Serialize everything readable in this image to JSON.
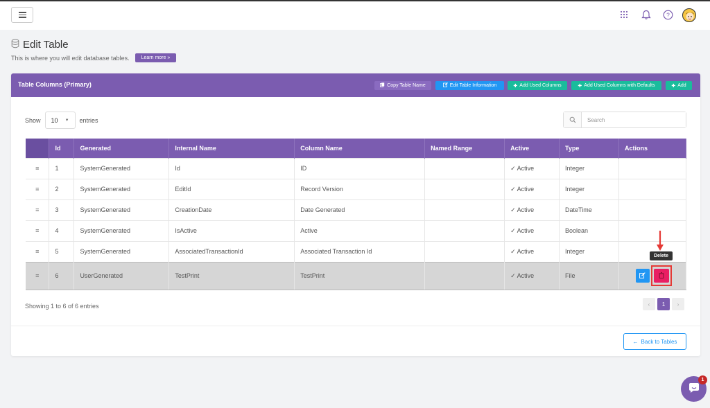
{
  "header": {
    "icons": [
      "menu-icon",
      "apps-grid-icon",
      "bell-icon",
      "help-icon",
      "user-avatar"
    ]
  },
  "page": {
    "title": "Edit Table",
    "subtitle": "This is where you will edit database tables.",
    "learn_more": "Learn more »"
  },
  "card": {
    "title": "Table Columns (Primary)",
    "buttons": {
      "copy": "Copy Table Name",
      "edit_info": "Edit Table Information",
      "add_used": "Add Used Columns",
      "add_used_defaults": "Add Used Columns with Defaults",
      "add": "Add"
    }
  },
  "controls": {
    "show_label": "Show",
    "entries_value": "10",
    "entries_label": "entries",
    "search_placeholder": "Search"
  },
  "table": {
    "headers": [
      "",
      "Id",
      "Generated",
      "Internal Name",
      "Column Name",
      "Named Range",
      "Active",
      "Type",
      "Actions"
    ],
    "rows": [
      {
        "handle": "≡",
        "id": "1",
        "generated": "SystemGenerated",
        "internal": "Id",
        "column": "ID",
        "range": "",
        "active": "✓ Active",
        "type": "Integer"
      },
      {
        "handle": "≡",
        "id": "2",
        "generated": "SystemGenerated",
        "internal": "EditId",
        "column": "Record Version",
        "range": "",
        "active": "✓ Active",
        "type": "Integer"
      },
      {
        "handle": "≡",
        "id": "3",
        "generated": "SystemGenerated",
        "internal": "CreationDate",
        "column": "Date Generated",
        "range": "",
        "active": "✓ Active",
        "type": "DateTime"
      },
      {
        "handle": "≡",
        "id": "4",
        "generated": "SystemGenerated",
        "internal": "IsActive",
        "column": "Active",
        "range": "",
        "active": "✓ Active",
        "type": "Boolean"
      },
      {
        "handle": "≡",
        "id": "5",
        "generated": "SystemGenerated",
        "internal": "AssociatedTransactionId",
        "column": "Associated Transaction Id",
        "range": "",
        "active": "✓ Active",
        "type": "Integer"
      },
      {
        "handle": "≡",
        "id": "6",
        "generated": "UserGenerated",
        "internal": "TestPrint",
        "column": "TestPrint",
        "range": "",
        "active": "✓ Active",
        "type": "File"
      }
    ]
  },
  "tooltip": "Delete",
  "footer": {
    "info": "Showing 1 to 6 of 6 entries",
    "page": "1",
    "prev": "‹",
    "next": "›",
    "back": "Back to Tables"
  },
  "chat": {
    "badge": "1"
  },
  "colors": {
    "primary": "#7b5cb0",
    "info": "#2196f3",
    "success": "#1abc9c",
    "danger": "#e91e63",
    "highlight": "#e53935"
  }
}
